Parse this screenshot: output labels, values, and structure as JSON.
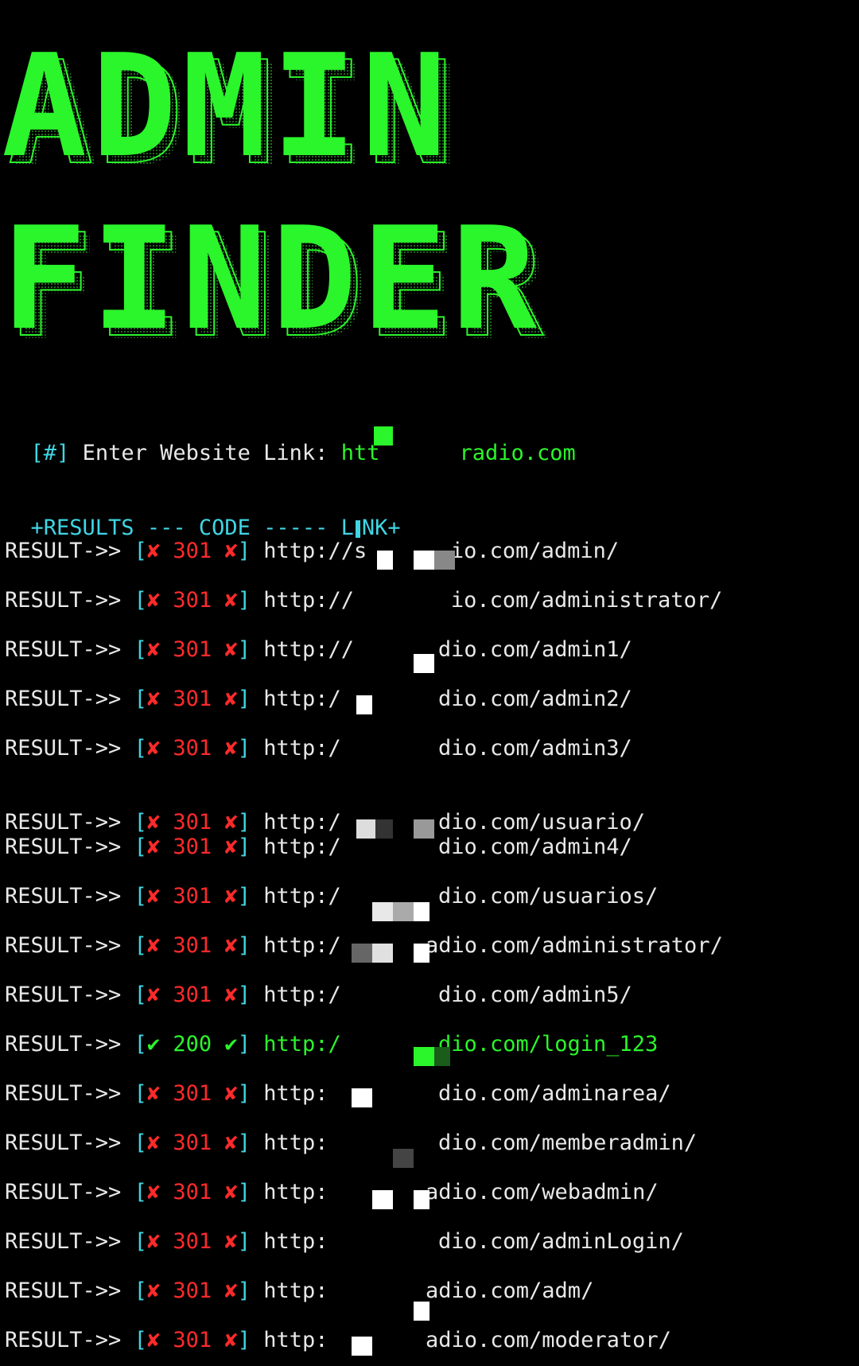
{
  "banner": {
    "line1": "ADMIN",
    "line2": "FINDER",
    "color": "#2bf52b"
  },
  "prompt": {
    "prefix": "[#]",
    "label": "Enter Website Link:",
    "value_start": "htt",
    "value_end": "radio.com"
  },
  "header": {
    "text_left": "+RESULTS --- CODE ----- L",
    "text_right": "NK+"
  },
  "result_label": "RESULT->>",
  "results": [
    {
      "status": "fail",
      "code": "301",
      "url_start": "http://s",
      "url_end": "io.com/admin/"
    },
    {
      "status": "fail",
      "code": "301",
      "url_start": "http://",
      "url_end": "io.com/administrator/"
    },
    {
      "status": "fail",
      "code": "301",
      "url_start": "http://",
      "url_end": "dio.com/admin1/"
    },
    {
      "status": "fail",
      "code": "301",
      "url_start": "http:/",
      "url_end": "dio.com/admin2/"
    },
    {
      "status": "fail",
      "code": "301",
      "url_start": "http:/",
      "url_end": "dio.com/admin3/"
    },
    {
      "status": "fail",
      "code": "301",
      "url_start": "http:/",
      "url_end": "dio.com/usuario/"
    },
    {
      "status": "fail",
      "code": "301",
      "url_start": "http:/",
      "url_end": "dio.com/admin4/"
    },
    {
      "status": "fail",
      "code": "301",
      "url_start": "http:/",
      "url_end": "dio.com/usuarios/"
    },
    {
      "status": "fail",
      "code": "301",
      "url_start": "http:/",
      "url_end": "adio.com/administrator/"
    },
    {
      "status": "fail",
      "code": "301",
      "url_start": "http:/",
      "url_end": "dio.com/admin5/"
    },
    {
      "status": "ok",
      "code": "200",
      "url_start": "http:/",
      "url_end": "dio.com/login_123"
    },
    {
      "status": "fail",
      "code": "301",
      "url_start": "http:",
      "url_end": "dio.com/adminarea/"
    },
    {
      "status": "fail",
      "code": "301",
      "url_start": "http:",
      "url_end": "dio.com/memberadmin/"
    },
    {
      "status": "fail",
      "code": "301",
      "url_start": "http:",
      "url_end": "adio.com/webadmin/"
    },
    {
      "status": "fail",
      "code": "301",
      "url_start": "http:",
      "url_end": "dio.com/adminLogin/"
    },
    {
      "status": "fail",
      "code": "301",
      "url_start": "http:",
      "url_end": "adio.com/adm/"
    },
    {
      "status": "fail",
      "code": "301",
      "url_start": "http:",
      "url_end": "adio.com/moderator/"
    }
  ]
}
